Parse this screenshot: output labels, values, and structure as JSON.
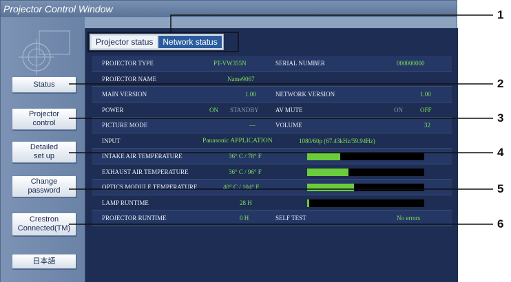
{
  "window": {
    "title": "Projector Control Window"
  },
  "sidebar": {
    "buttons": [
      {
        "label": "Status"
      },
      {
        "label": "Projector control"
      },
      {
        "label": "Detailed set up"
      },
      {
        "label": "Change password"
      },
      {
        "label": "Crestron Connected(TM)"
      },
      {
        "label": "日本語"
      }
    ]
  },
  "tabs": [
    {
      "label": "Projector status",
      "active": false
    },
    {
      "label": "Network status",
      "active": true
    }
  ],
  "status": {
    "projector_type_label": "PROJECTOR TYPE",
    "projector_type": "PT-VW355N",
    "serial_label": "SERIAL NUMBER",
    "serial": "000000000",
    "projector_name_label": "PROJECTOR NAME",
    "projector_name": "Name9067",
    "main_version_label": "MAIN VERSION",
    "main_version": "1.00",
    "network_version_label": "NETWORK VERSION",
    "network_version": "1.00",
    "power_label": "POWER",
    "power_on": "ON",
    "power_standby": "STANDBY",
    "av_mute_label": "AV MUTE",
    "av_mute_on": "ON",
    "av_mute_off": "OFF",
    "picture_mode_label": "PICTURE MODE",
    "picture_mode": "—",
    "volume_label": "VOLUME",
    "volume": "32",
    "input_label": "INPUT",
    "input": "Panasonic APPLICATION",
    "input_signal": "1080/60p (67.43kHz/59.94Hz)",
    "intake_label": "INTAKE AIR TEMPERATURE",
    "intake": "36° C / 78° F",
    "intake_level": 0.28,
    "exhaust_label": "EXHAUST AIR TEMPERATURE",
    "exhaust": "36° C / 96° F",
    "exhaust_level": 0.35,
    "optics_label": "OPTICS MODULE TEMPERATURE",
    "optics": "40° C / 104° F",
    "optics_level": 0.4,
    "lamp_label": "LAMP RUNTIME",
    "lamp": "28 H",
    "lamp_level": 0.02,
    "runtime_label": "PROJECTOR RUNTIME",
    "runtime": "0 H",
    "selftest_label": "SELF TEST",
    "selftest": "No errors"
  },
  "callouts": [
    "1",
    "2",
    "3",
    "4",
    "5",
    "6"
  ],
  "colors": {
    "accent": "#2b5c9e",
    "value_green": "#7fe05a",
    "bar_fill": "#6acb3d",
    "panel_bg": "#1e2d53"
  }
}
